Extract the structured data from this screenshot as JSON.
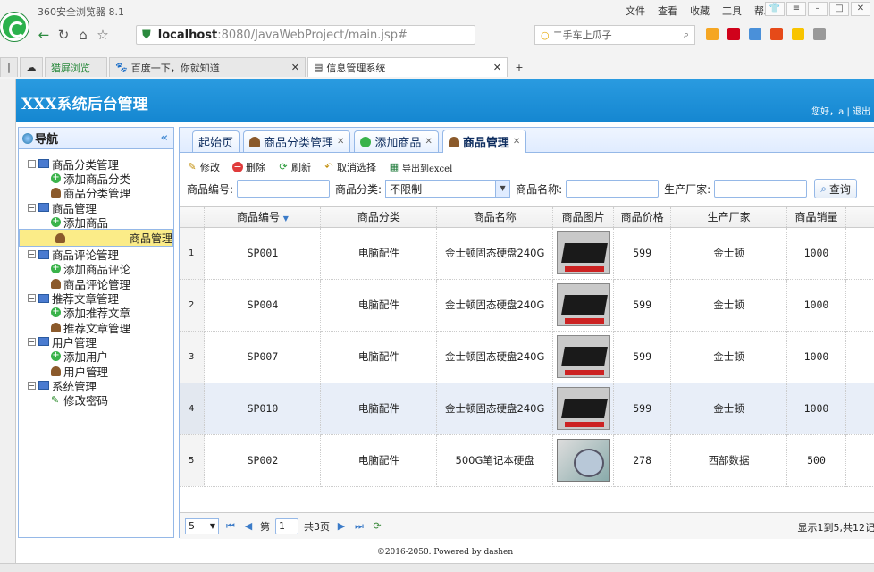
{
  "browser": {
    "title": "360安全浏览器 8.1",
    "menus": [
      "文件",
      "查看",
      "收藏",
      "工具",
      "帮助"
    ],
    "url_host": "localhost",
    "url_rest": ":8080/JavaWebProject/main.jsp#",
    "search_placeholder": "二手车上瓜子",
    "tabs": [
      "猎屏浏览",
      "百度一下，你就知道",
      "信息管理系统"
    ]
  },
  "app": {
    "title": "XXX系统后台管理",
    "greeting": "您好，a  |  退出"
  },
  "sidebar": {
    "header": "导航",
    "groups": [
      {
        "label": "商品分类管理",
        "items": [
          "添加商品分类",
          "商品分类管理"
        ]
      },
      {
        "label": "商品管理",
        "items": [
          "添加商品",
          "商品管理"
        ]
      },
      {
        "label": "商品评论管理",
        "items": [
          "添加商品评论",
          "商品评论管理"
        ]
      },
      {
        "label": "推荐文章管理",
        "items": [
          "添加推荐文章",
          "推荐文章管理"
        ]
      },
      {
        "label": "用户管理",
        "items": [
          "添加用户",
          "用户管理"
        ]
      },
      {
        "label": "系统管理",
        "items": [
          "修改密码"
        ]
      }
    ]
  },
  "main": {
    "tabs": [
      "起始页",
      "商品分类管理",
      "添加商品",
      "商品管理"
    ],
    "toolbar": {
      "edit": "修改",
      "delete": "删除",
      "refresh": "刷新",
      "cancel": "取消选择",
      "export": "导出到excel"
    },
    "filters": {
      "code_label": "商品编号:",
      "category_label": "商品分类:",
      "category_value": "不限制",
      "name_label": "商品名称:",
      "maker_label": "生产厂家:",
      "query": "查询"
    },
    "columns": [
      "商品编号",
      "商品分类",
      "商品名称",
      "商品图片",
      "商品价格",
      "生产厂家",
      "商品销量"
    ],
    "rows": [
      {
        "n": "1",
        "code": "SP001",
        "cat": "电脑配件",
        "name": "金士顿固态硬盘240G",
        "price": "599",
        "maker": "金士顿",
        "sales": "1000"
      },
      {
        "n": "2",
        "code": "SP004",
        "cat": "电脑配件",
        "name": "金士顿固态硬盘240G",
        "price": "599",
        "maker": "金士顿",
        "sales": "1000"
      },
      {
        "n": "3",
        "code": "SP007",
        "cat": "电脑配件",
        "name": "金士顿固态硬盘240G",
        "price": "599",
        "maker": "金士顿",
        "sales": "1000"
      },
      {
        "n": "4",
        "code": "SP010",
        "cat": "电脑配件",
        "name": "金士顿固态硬盘240G",
        "price": "599",
        "maker": "金士顿",
        "sales": "1000"
      },
      {
        "n": "5",
        "code": "SP002",
        "cat": "电脑配件",
        "name": "500G笔记本硬盘",
        "price": "278",
        "maker": "西部数据",
        "sales": "500"
      }
    ],
    "pager": {
      "page_size": "5",
      "page_label": "第",
      "page": "1",
      "total_pages": "共3页",
      "info": "显示1到5,共12记"
    }
  },
  "footer": "©2016-2050. Powered by dashen"
}
